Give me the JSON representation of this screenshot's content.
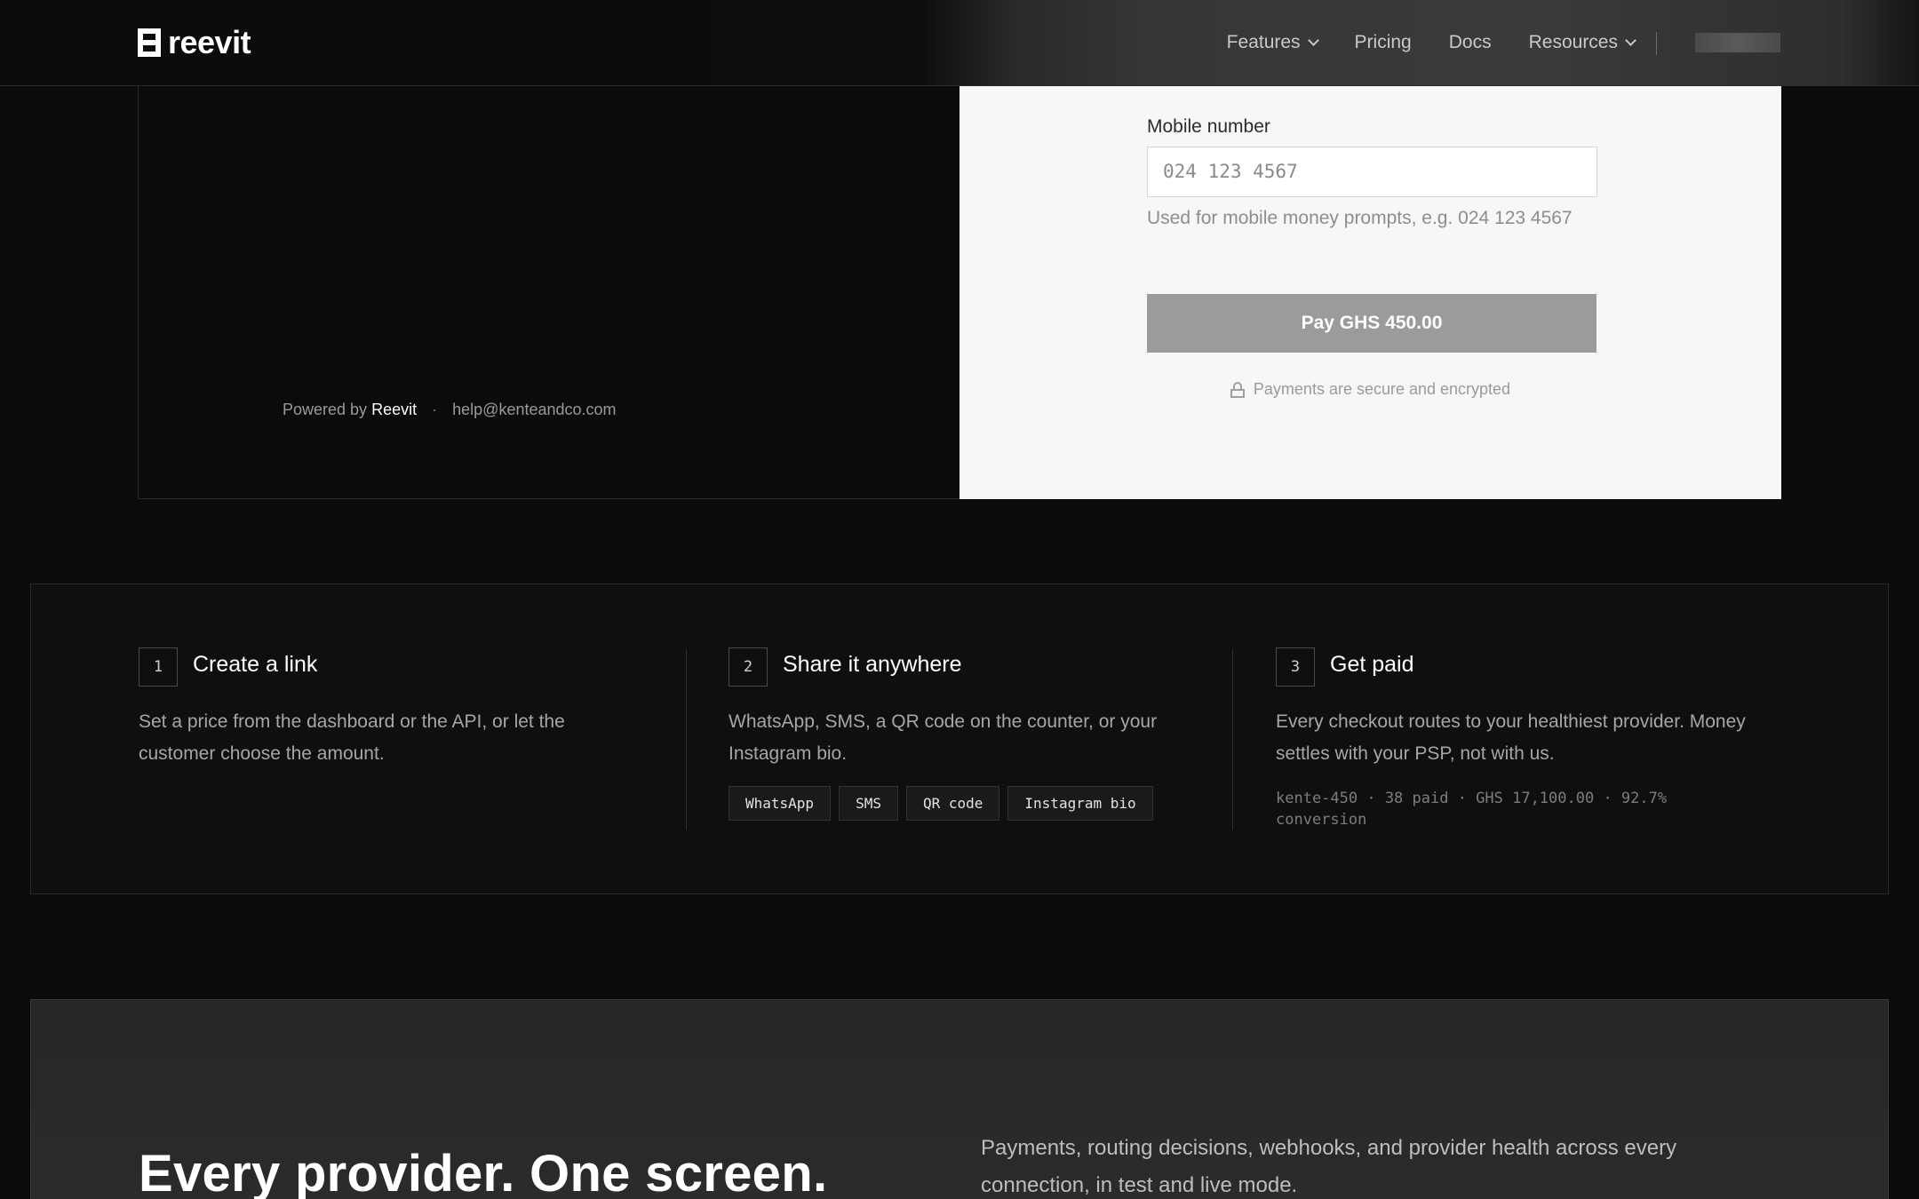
{
  "nav": {
    "brand": "reevit",
    "links": [
      {
        "label": "Features",
        "dropdown": true
      },
      {
        "label": "Pricing",
        "dropdown": false
      },
      {
        "label": "Docs",
        "dropdown": false
      },
      {
        "label": "Resources",
        "dropdown": true
      }
    ]
  },
  "checkout": {
    "powered_prefix": "Powered by",
    "powered_brand": "Reevit",
    "separator": "·",
    "support_email": "help@kenteandco.com",
    "mobile_label": "Mobile number",
    "mobile_placeholder": "024 123 4567",
    "mobile_help": "Used for mobile money prompts, e.g. 024 123 4567",
    "pay_button": "Pay GHS 450.00",
    "secure_note": "Payments are secure and encrypted"
  },
  "steps": [
    {
      "number": "1",
      "title": "Create a link",
      "description": "Set a price from the dashboard or the API, or let the customer choose the amount."
    },
    {
      "number": "2",
      "title": "Share it anywhere",
      "description": "WhatsApp, SMS, a QR code on the counter, or your Instagram bio.",
      "tags": [
        "WhatsApp",
        "SMS",
        "QR code",
        "Instagram bio"
      ]
    },
    {
      "number": "3",
      "title": "Get paid",
      "description": "Every checkout routes to your healthiest provider. Money settles with your PSP, not with us.",
      "stats": "kente-450 · 38 paid · GHS 17,100.00 · 92.7% conversion"
    }
  ],
  "overview": {
    "heading": "Every provider. One screen.",
    "body": "Payments, routing decisions, webhooks, and provider health across every connection, in test and live mode."
  },
  "colors": {
    "background": "#0b0b0b",
    "card_light": "#f7f7f7",
    "pay_button": "#9b9b9b"
  },
  "icons": [
    "reevit-logo-icon",
    "chevron-down-icon",
    "lock-icon"
  ]
}
